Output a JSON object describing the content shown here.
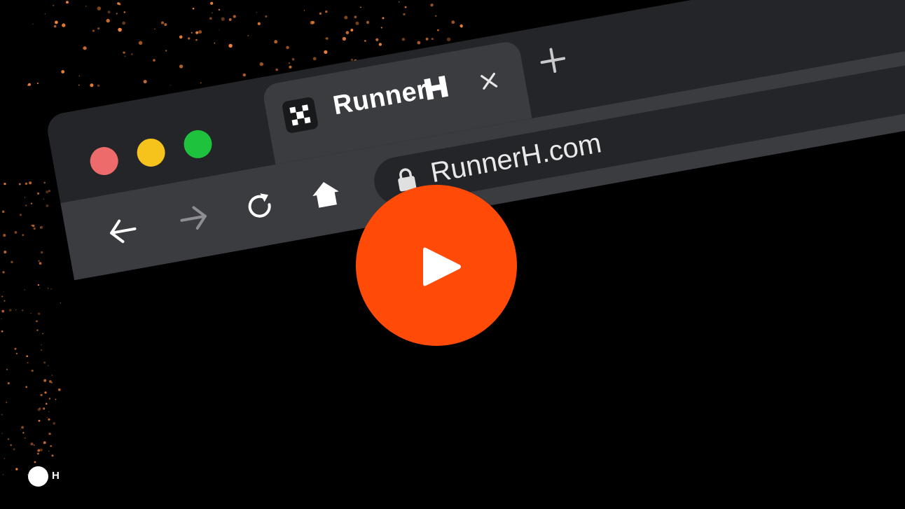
{
  "browser": {
    "tab": {
      "title": "Runner",
      "favicon_icon": "runner-h-logo-icon",
      "close_icon": "close-icon"
    },
    "new_tab_icon": "plus-icon",
    "window_controls": {
      "close_color": "#ee6b6b",
      "minimize_color": "#f5c31b",
      "maximize_color": "#1fc23c"
    },
    "toolbar": {
      "back_icon": "arrow-left-icon",
      "forward_icon": "arrow-right-icon",
      "reload_icon": "reload-icon",
      "home_icon": "home-icon"
    },
    "address_bar": {
      "lock_icon": "lock-icon",
      "url": "RunnerH.com"
    }
  },
  "video": {
    "play_icon": "play-icon",
    "accent_color": "#ff4a08"
  },
  "brand_badge": {
    "letter": "H"
  },
  "colors": {
    "background": "#000000",
    "title_bar": "#242528",
    "toolbar": "#3b3c40",
    "sparkle": "#ff8a3c"
  }
}
